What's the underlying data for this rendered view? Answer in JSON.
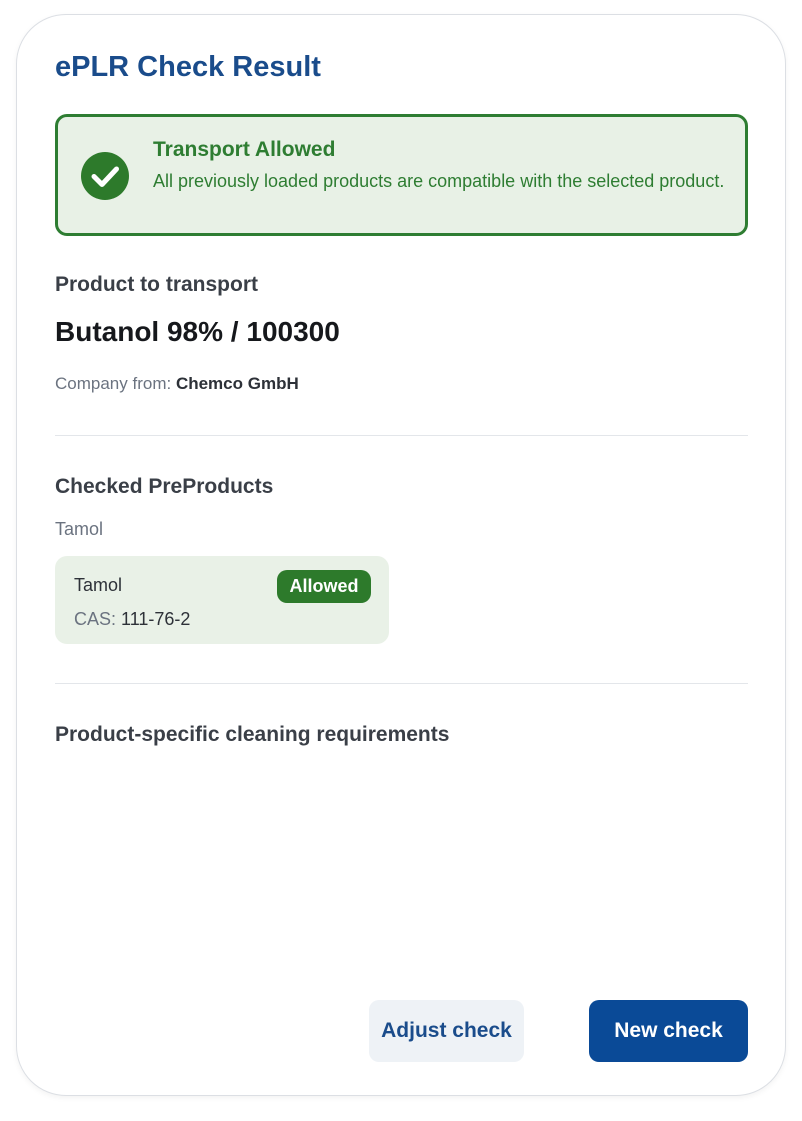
{
  "page": {
    "title": "ePLR Check Result"
  },
  "status": {
    "title": "Transport Allowed",
    "message": "All previously loaded products are compatible with the selected product.",
    "icon": "check-circle-icon",
    "color": "#2e7d32",
    "background": "#e8f1e6"
  },
  "product": {
    "heading": "Product to transport",
    "name": "Butanol 98% / 100300",
    "company_label": "Company from:",
    "company_value": "Chemco GmbH"
  },
  "preproducts": {
    "heading": "Checked PreProducts",
    "group_label": "Tamol",
    "items": [
      {
        "name": "Tamol",
        "badge": "Allowed",
        "cas_label": "CAS:",
        "cas_value": "111-76-2"
      }
    ]
  },
  "cleaning": {
    "heading": "Product-specific cleaning requirements"
  },
  "actions": {
    "adjust_label": "Adjust check",
    "new_label": "New check"
  },
  "colors": {
    "brand_primary": "#0a4a97",
    "title_blue": "#1a4c8b",
    "success_green": "#2d7a2b"
  }
}
